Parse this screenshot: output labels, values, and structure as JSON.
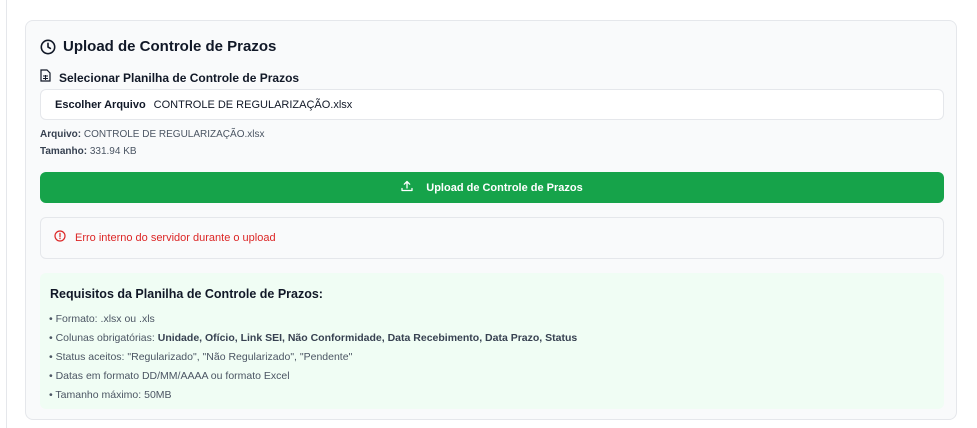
{
  "card": {
    "title": "Upload de Controle de Prazos",
    "file_label": "Selecionar Planilha de Controle de Prazos",
    "choose_button": "Escolher Arquivo",
    "chosen_file": "CONTROLE DE REGULARIZAÇÃO.xlsx",
    "file_meta_label": "Arquivo:",
    "file_meta_value": "CONTROLE DE REGULARIZAÇÃO.xlsx",
    "size_meta_label": "Tamanho:",
    "size_meta_value": "331.94 KB",
    "upload_button": "Upload de Controle de Prazos",
    "error_message": "Erro interno do servidor durante o upload"
  },
  "requirements": {
    "title": "Requisitos da Planilha de Controle de Prazos:",
    "items": [
      {
        "text": "• Formato: .xlsx ou .xls"
      },
      {
        "prefix": "• Colunas obrigatórias: ",
        "bold": "Unidade, Ofício, Link SEI, Não Conformidade, Data Recebimento, Data Prazo, Status"
      },
      {
        "text": "• Status aceitos: \"Regularizado\", \"Não Regularizado\", \"Pendente\""
      },
      {
        "text": "• Datas em formato DD/MM/AAAA ou formato Excel"
      },
      {
        "text": "• Tamanho máximo: 50MB"
      }
    ]
  },
  "colors": {
    "primary_button": "#16a34a",
    "error": "#dc2626",
    "requirements_bg": "#f0fdf4"
  },
  "icons": {
    "title_icon": "clock-icon",
    "file_icon": "spreadsheet-file-icon",
    "upload_icon": "upload-icon",
    "error_icon": "alert-circle-icon"
  }
}
